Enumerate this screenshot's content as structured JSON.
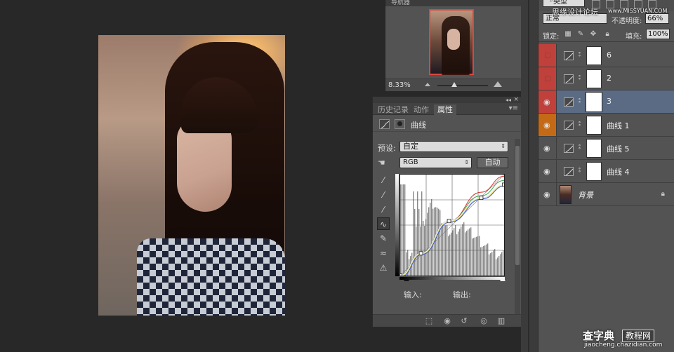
{
  "navigator": {
    "tab_label": "导航器",
    "zoom": "8.33%"
  },
  "properties": {
    "tabs": [
      {
        "label": "历史记录",
        "active": false
      },
      {
        "label": "动作",
        "active": false
      },
      {
        "label": "属性",
        "active": true
      }
    ],
    "title": "曲线",
    "preset_label": "预设:",
    "preset_value": "自定",
    "channel_value": "RGB",
    "auto_label": "自动",
    "input_label": "输入:",
    "output_label": "输出:",
    "curve_points": [
      [
        0,
        0
      ],
      [
        0.2,
        0.22
      ],
      [
        0.47,
        0.54
      ],
      [
        0.78,
        0.77
      ],
      [
        1.0,
        0.9
      ]
    ]
  },
  "layers": {
    "filter_value": "类型",
    "blend_mode": "正常",
    "opacity_label": "不透明度:",
    "opacity_value": "66%",
    "lock_label": "锁定:",
    "fill_label": "填充:",
    "fill_value": "100%",
    "rows": [
      {
        "name": "6",
        "visibility": "off",
        "cell_color": "#c0413c",
        "selected": false
      },
      {
        "name": "2",
        "visibility": "off",
        "cell_color": "#c0413c",
        "selected": false
      },
      {
        "name": "3",
        "visibility": "on",
        "cell_color": "#c0413c",
        "selected": true
      },
      {
        "name": "曲线 1",
        "visibility": "on",
        "cell_color": "#c46a17",
        "selected": false
      },
      {
        "name": "曲线 5",
        "visibility": "on",
        "cell_color": "#535353",
        "selected": false
      },
      {
        "name": "曲线 4",
        "visibility": "on",
        "cell_color": "#535353",
        "selected": false
      }
    ],
    "background_name": "背景"
  },
  "watermarks": {
    "top": "思缘设计论坛",
    "top_url": "www.MISSYUAN.COM",
    "bottom_brand": "查字典",
    "bottom_box": "教程网",
    "bottom_url": "jiaocheng.chazidian.com"
  },
  "colors": {
    "selected_row": "#5b6b84",
    "red_label": "#c0413c",
    "orange_label": "#c46a17"
  }
}
